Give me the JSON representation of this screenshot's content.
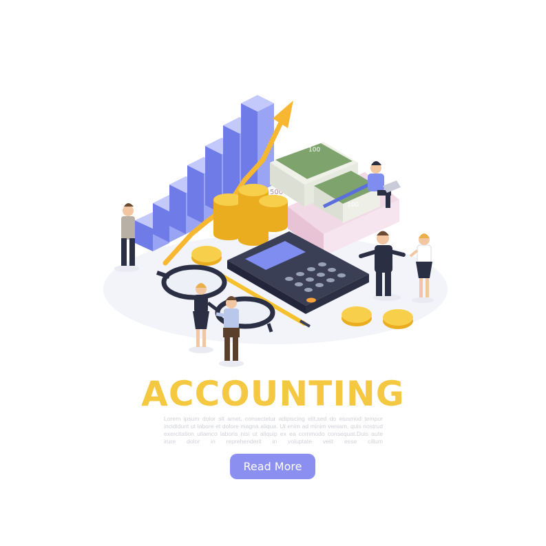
{
  "hero": {
    "title": "ACCOUNTING",
    "body": "Lorem ipsum dolor sit amet, consectetur adipiscing elit,sed do eiusmod tempor incididunt ut labore et dolore magna aliqua. Ut enim ad minim veniam, quis nostrud exercitation ullamco laboris nisi ut aliquip ex ea commodo consequat.Duis aute irure dolor in reprehenderit in voluptate velit esse cillum",
    "button_label": "Read More"
  },
  "illustration": {
    "banknote_value": "100",
    "banknote_value_alt": "500",
    "coin_symbol": "$"
  },
  "colors": {
    "title": "#f5c842",
    "button": "#8a8ff0",
    "bars": "#7f8cf0",
    "coin": "#f6c12e",
    "calculator": "#2f3346",
    "arrow": "#f7b731"
  }
}
